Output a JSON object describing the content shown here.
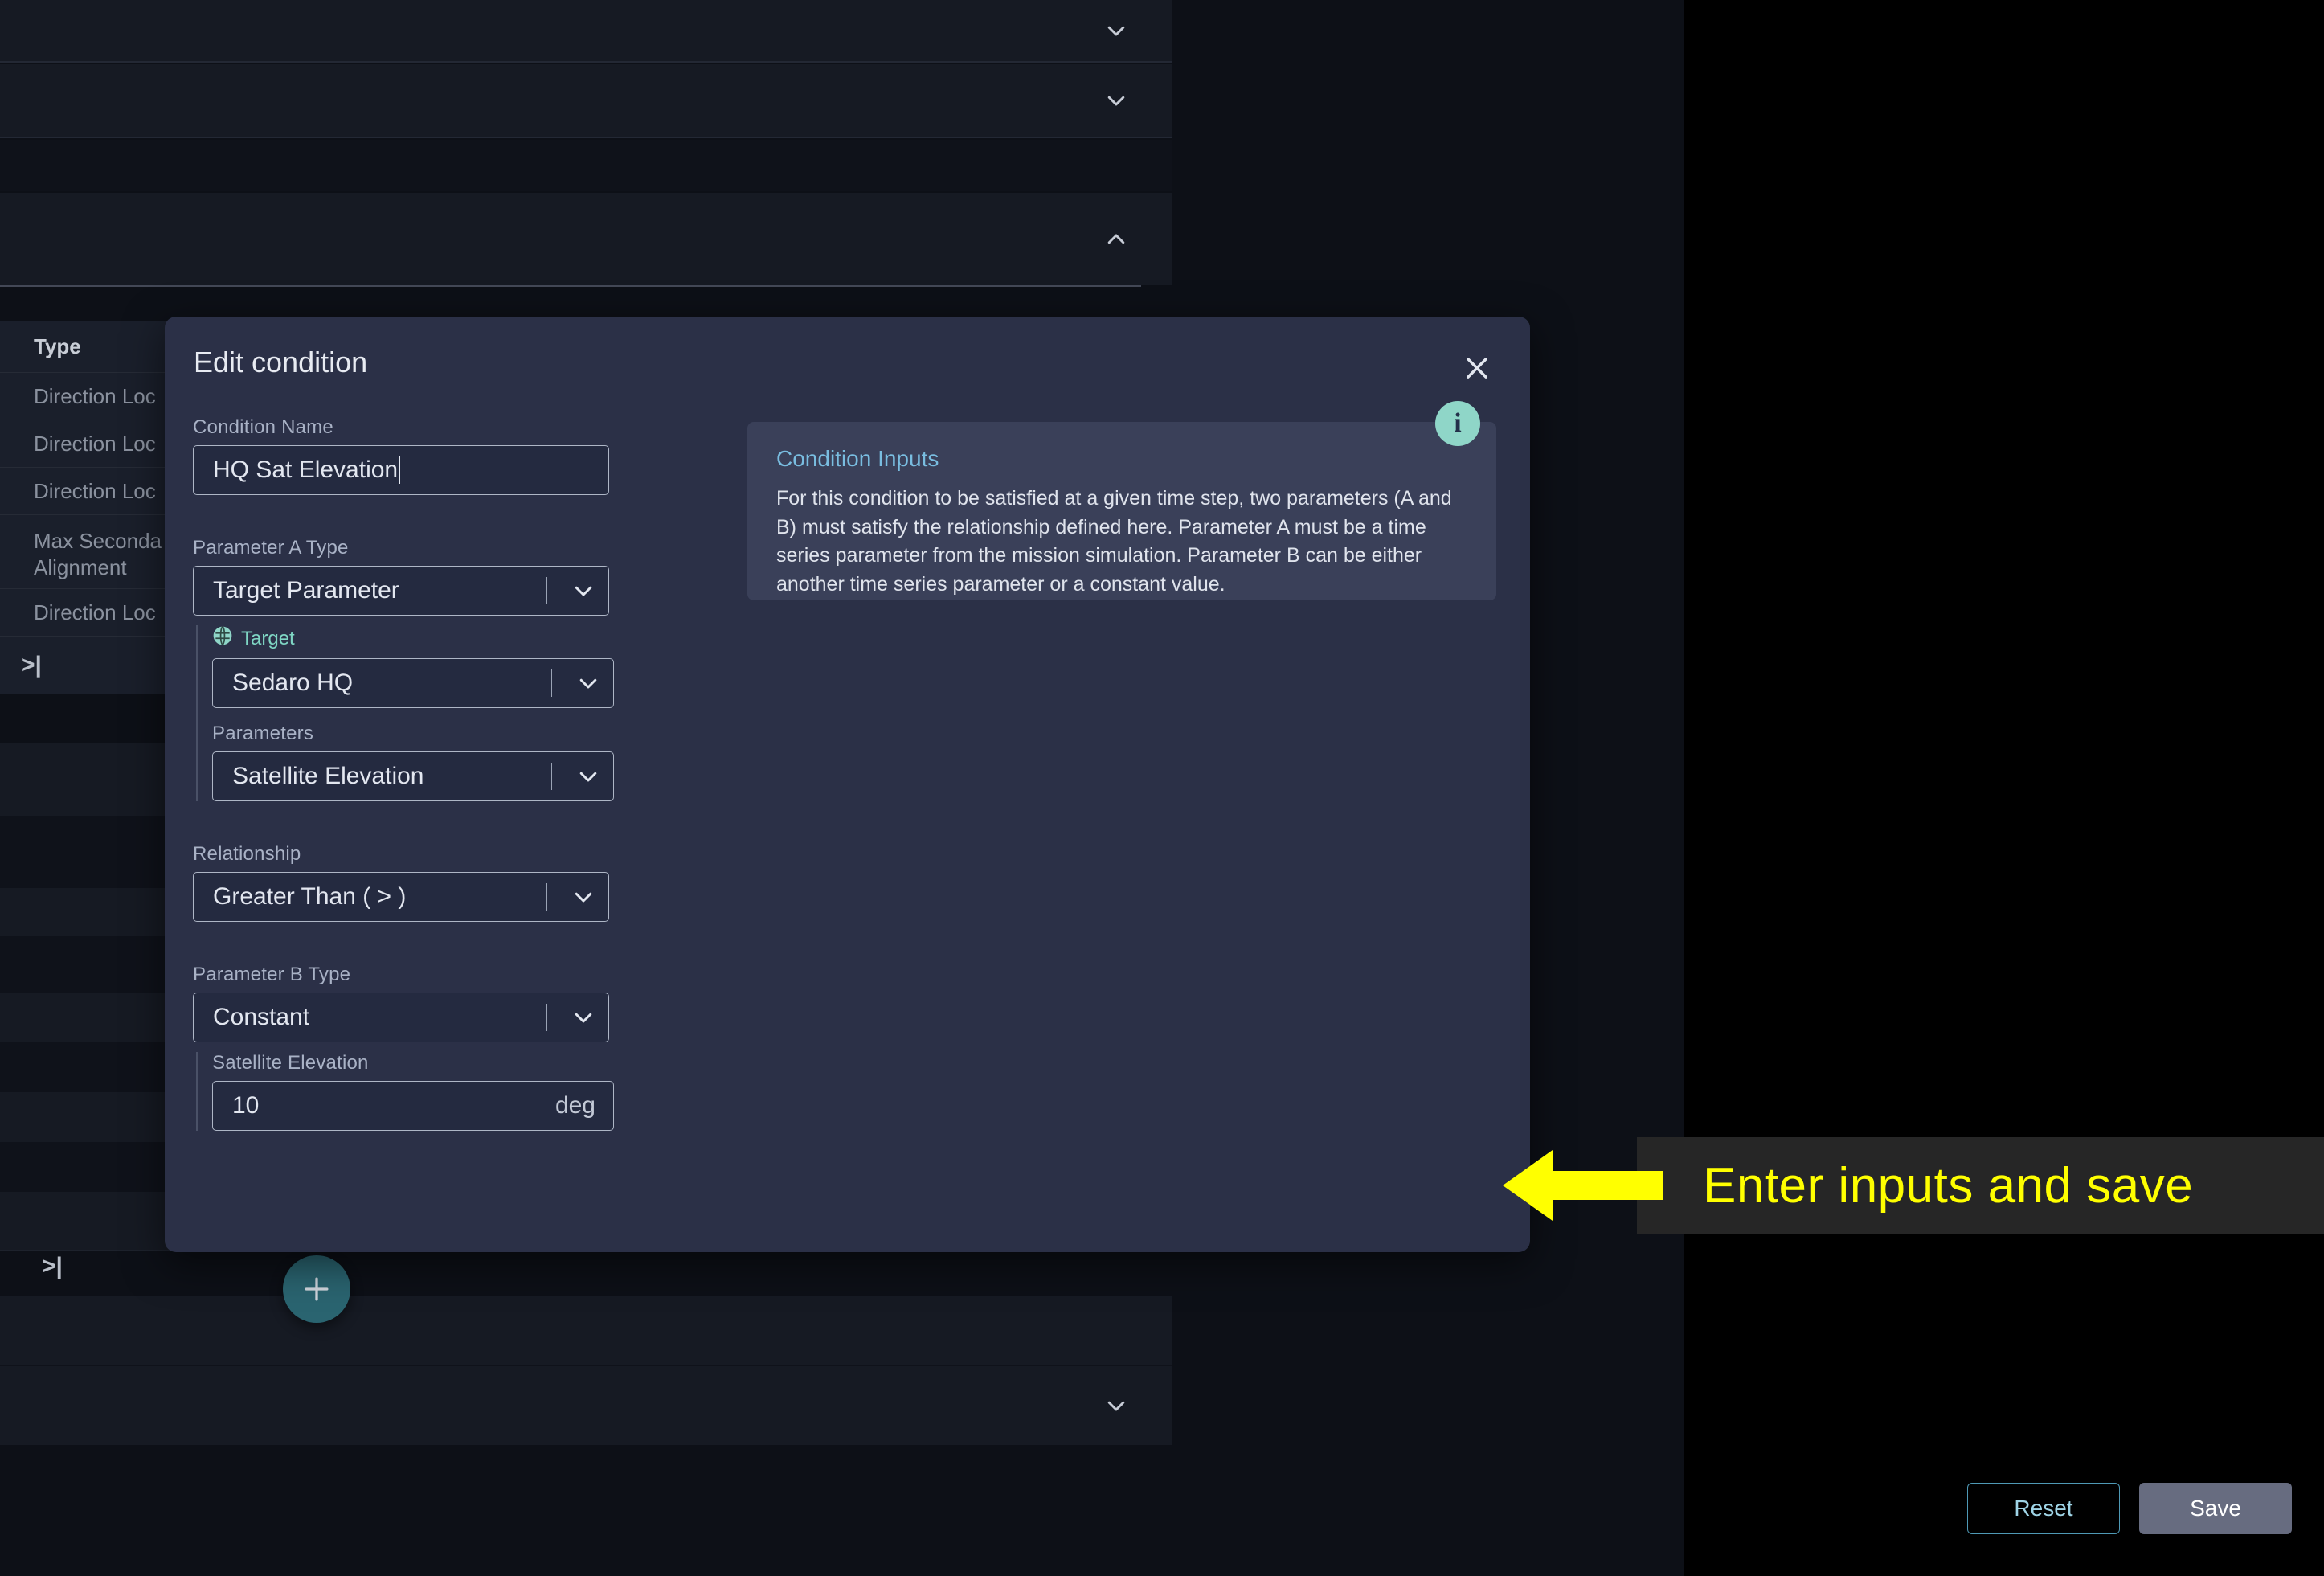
{
  "background": {
    "table": {
      "column_header": "Type",
      "rows": [
        "Direction Loc",
        "Direction Loc",
        "Direction Loc",
        "Max Seconda\nAlignment",
        "Direction Loc"
      ],
      "pager_icon": "skip-to-end-icon",
      "pager_label": ">|"
    },
    "accordions": [
      {
        "icon": "chevron-down-icon",
        "state": "collapsed"
      },
      {
        "icon": "chevron-down-icon",
        "state": "collapsed"
      },
      {
        "icon": "chevron-up-icon",
        "state": "expanded"
      },
      {
        "icon": "chevron-down-icon",
        "state": "collapsed"
      }
    ],
    "add_button": {
      "icon": "plus-icon",
      "label": "+",
      "color": "#2a6470"
    }
  },
  "modal": {
    "title": "Edit condition",
    "close_icon": "close-icon",
    "form": {
      "condition_name": {
        "label": "Condition Name",
        "value": "HQ Sat Elevation",
        "placeholder": "Condition Name",
        "focused": true
      },
      "parameter_a_type": {
        "label": "Parameter A Type",
        "value": "Target Parameter",
        "options": [
          "Target Parameter"
        ]
      },
      "target": {
        "label": "Target",
        "icon": "globe-icon",
        "value": "Sedaro HQ",
        "options": [
          "Sedaro HQ"
        ]
      },
      "parameters": {
        "label": "Parameters",
        "value": "Satellite Elevation",
        "options": [
          "Satellite Elevation"
        ]
      },
      "relationship": {
        "label": "Relationship",
        "value": "Greater Than ( > )",
        "options": [
          "Greater Than ( > )"
        ]
      },
      "parameter_b_type": {
        "label": "Parameter B Type",
        "value": "Constant",
        "options": [
          "Constant"
        ]
      },
      "constant_value": {
        "label": "Satellite Elevation",
        "value": "10",
        "unit": "deg"
      }
    },
    "info": {
      "badge_icon": "info-icon",
      "badge_label": "i",
      "title": "Condition Inputs",
      "body": "For this condition to be satisfied at a given time step, two parameters (A and B) must satisfy the relationship defined here. Parameter A must be a time series parameter from the mission simulation. Parameter B can be either another time series parameter or a constant value."
    },
    "actions": {
      "reset_label": "Reset",
      "save_label": "Save"
    }
  },
  "annotation": {
    "text": "Enter inputs and save",
    "arrow_icon": "arrow-left-icon",
    "text_color": "#ffff00",
    "band_color": "#262626"
  }
}
